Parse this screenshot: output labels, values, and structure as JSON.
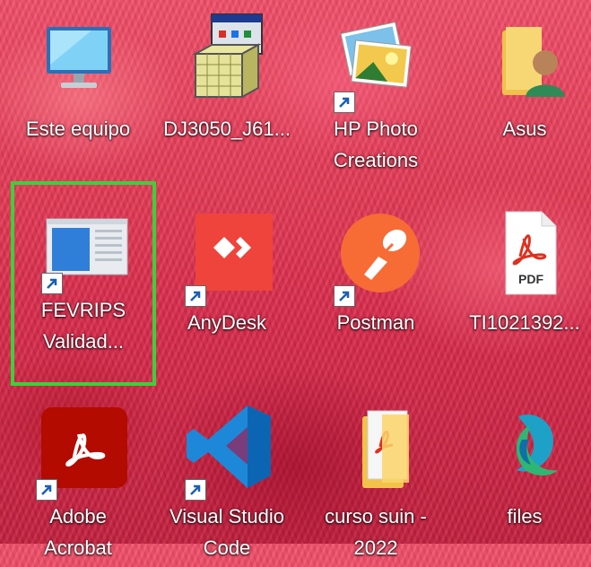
{
  "desktop": {
    "selection_color": "#3ad13a",
    "icons": [
      {
        "label": "Este equipo",
        "icon": "computer-icon",
        "shortcut": false
      },
      {
        "label": "DJ3050_J61...",
        "icon": "installer-icon",
        "shortcut": false
      },
      {
        "label": "HP Photo\nCreations",
        "icon": "photos-icon",
        "shortcut": true
      },
      {
        "label": "Asus",
        "icon": "user-folder-icon",
        "shortcut": false
      },
      {
        "label": "FEVRIPS\nValidad...",
        "icon": "app-window-icon",
        "shortcut": true,
        "selected": true
      },
      {
        "label": "AnyDesk",
        "icon": "anydesk-icon",
        "shortcut": true
      },
      {
        "label": "Postman",
        "icon": "postman-icon",
        "shortcut": true
      },
      {
        "label": "TI1021392...",
        "icon": "pdf-file-icon",
        "shortcut": false,
        "badge": "PDF"
      },
      {
        "label": "Adobe\nAcrobat",
        "icon": "acrobat-icon",
        "shortcut": true
      },
      {
        "label": "Visual Studio\nCode",
        "icon": "vscode-icon",
        "shortcut": true
      },
      {
        "label": "curso suin -\n2022",
        "icon": "pdf-folder-icon",
        "shortcut": false
      },
      {
        "label": "files",
        "icon": "files-app-icon",
        "shortcut": false
      }
    ]
  }
}
